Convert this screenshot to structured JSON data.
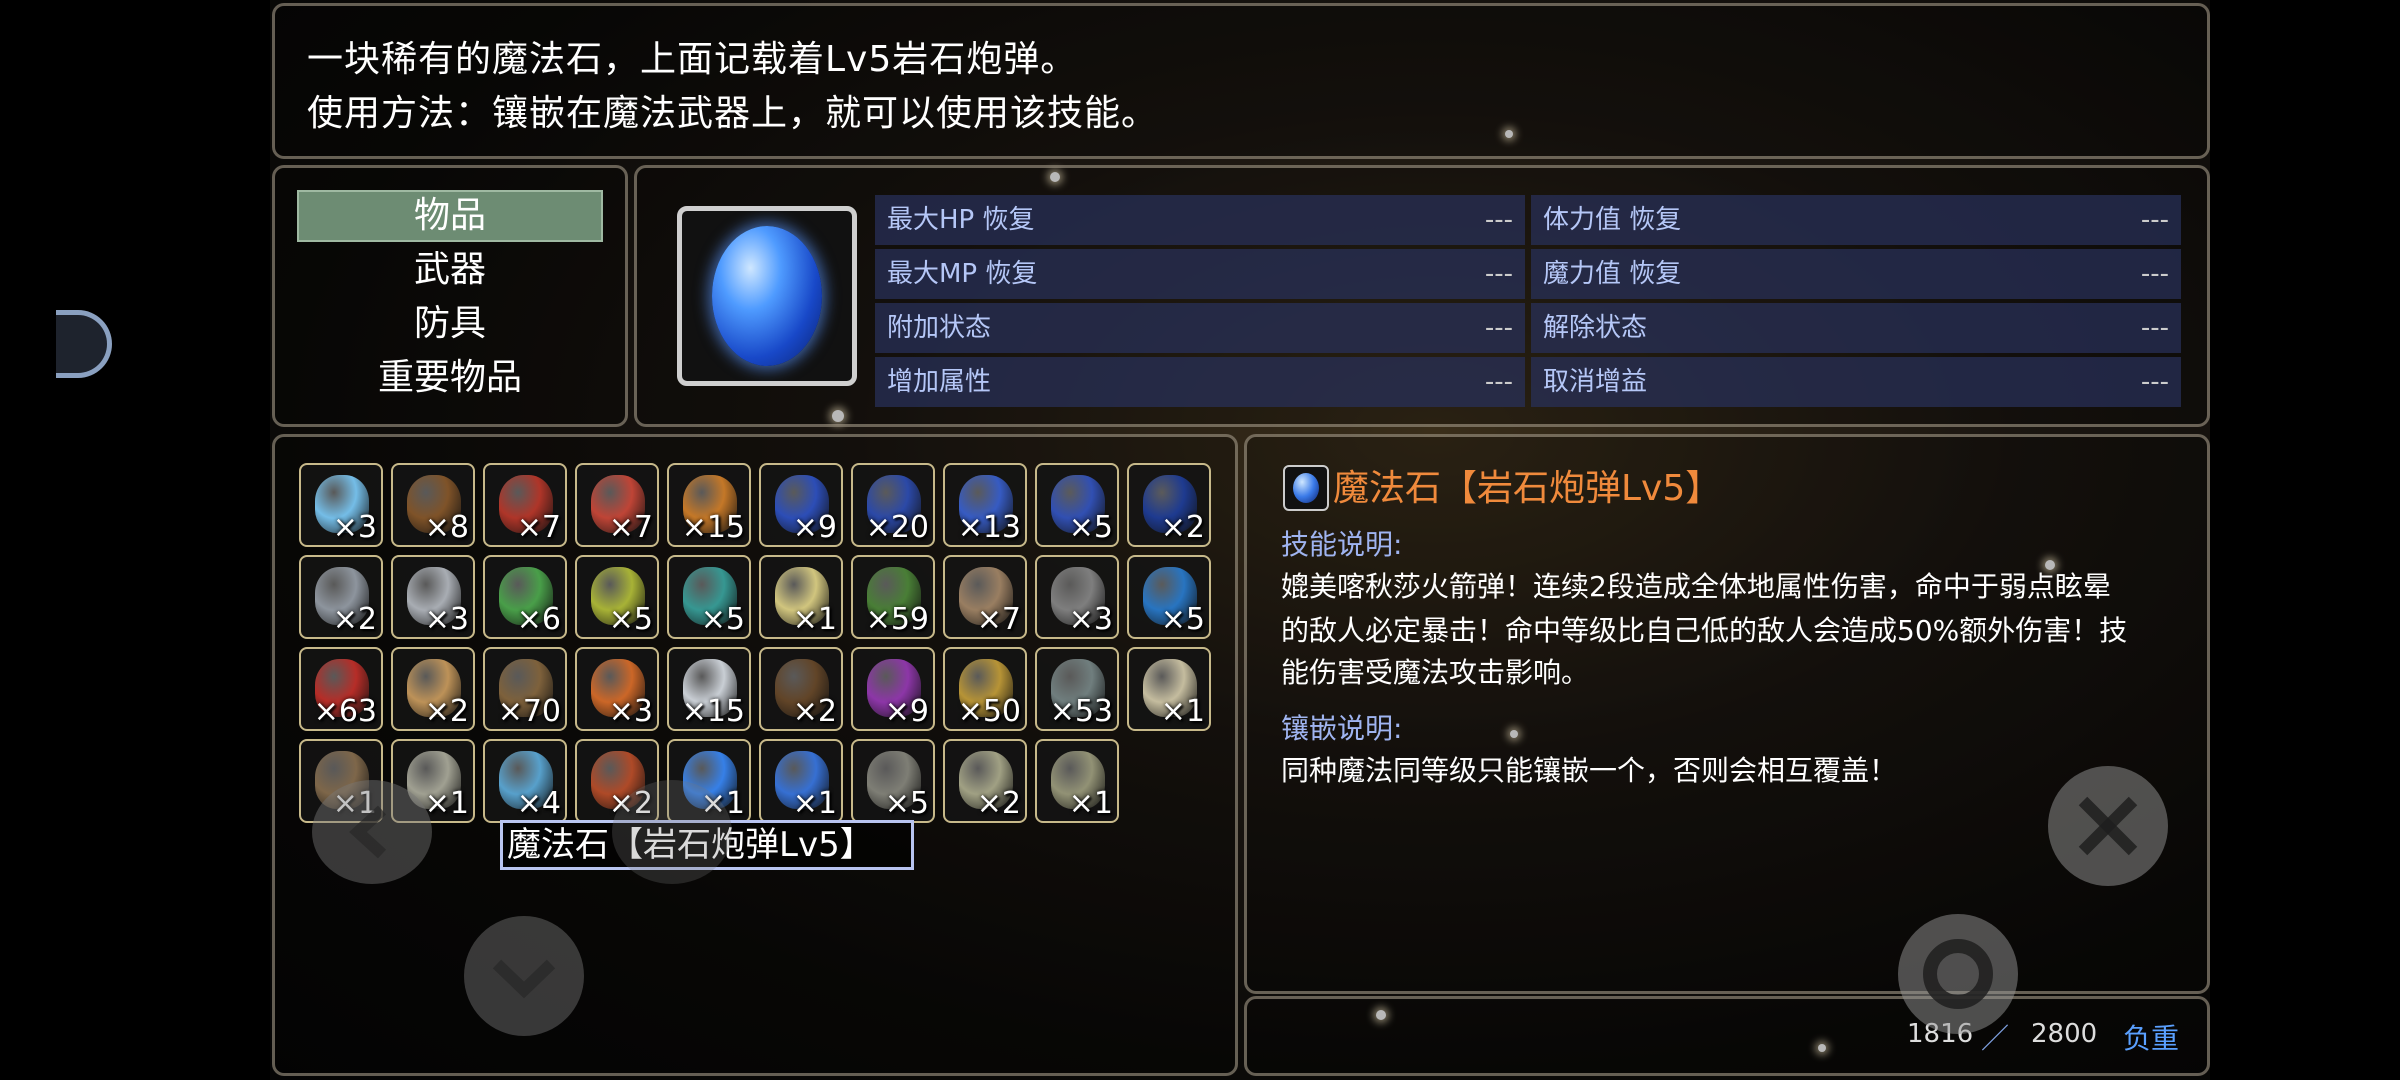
{
  "help": {
    "line1": "一块稀有的魔法石，上面记载着Lv5岩石炮弹。",
    "line2": "使用方法：镶嵌在魔法武器上，就可以使用该技能。"
  },
  "categories": [
    "物品",
    "武器",
    "防具",
    "重要物品"
  ],
  "selected_category": "物品",
  "stats": [
    {
      "label": "最大HP 恢复",
      "value": "---"
    },
    {
      "label": "体力值 恢复",
      "value": "---"
    },
    {
      "label": "最大MP 恢复",
      "value": "---"
    },
    {
      "label": "魔力值 恢复",
      "value": "---"
    },
    {
      "label": "附加状态",
      "value": "---"
    },
    {
      "label": "解除状态",
      "value": "---"
    },
    {
      "label": "增加属性",
      "value": "---"
    },
    {
      "label": "取消增益",
      "value": "---"
    }
  ],
  "inventory": [
    {
      "icon": "crystal-bottle-icon",
      "count": "×3",
      "color": "#7fd0ff"
    },
    {
      "icon": "chest-icon",
      "count": "×8",
      "color": "#8b5a2b"
    },
    {
      "icon": "red-potion-icon",
      "count": "×7",
      "color": "#c0392b"
    },
    {
      "icon": "red-potion-icon",
      "count": "×7",
      "color": "#d24a3a"
    },
    {
      "icon": "orange-potion-icon",
      "count": "×15",
      "color": "#d8832a"
    },
    {
      "icon": "blue-potion-icon",
      "count": "×9",
      "color": "#2f54c9"
    },
    {
      "icon": "blue-potion-icon",
      "count": "×20",
      "color": "#2e4fb8"
    },
    {
      "icon": "blue-potion-icon",
      "count": "×13",
      "color": "#3a63d6"
    },
    {
      "icon": "blue-potion-icon",
      "count": "×5",
      "color": "#3456c4"
    },
    {
      "icon": "blue-flask-icon",
      "count": "×2",
      "color": "#1f3f9e"
    },
    {
      "icon": "grey-potion-icon",
      "count": "×2",
      "color": "#9ba3ad"
    },
    {
      "icon": "grey-potion-icon",
      "count": "×3",
      "color": "#b9bec5"
    },
    {
      "icon": "green-potion-icon",
      "count": "×6",
      "color": "#4fae4f"
    },
    {
      "icon": "yellow-green-potion-icon",
      "count": "×5",
      "color": "#b8c43a"
    },
    {
      "icon": "teal-potion-icon",
      "count": "×5",
      "color": "#3aa6a0"
    },
    {
      "icon": "skull-flask-icon",
      "count": "×1",
      "color": "#e6d98a"
    },
    {
      "icon": "herb-icon",
      "count": "×59",
      "color": "#4f8a3a"
    },
    {
      "icon": "root-icon",
      "count": "×7",
      "color": "#a88a6a"
    },
    {
      "icon": "lantern-icon",
      "count": "×3",
      "color": "#8a8a8a"
    },
    {
      "icon": "blue-orb-icon",
      "count": "×5",
      "color": "#2a7fd4"
    },
    {
      "icon": "apple-icon",
      "count": "×63",
      "color": "#c8302a"
    },
    {
      "icon": "bread-icon",
      "count": "×2",
      "color": "#d0a060"
    },
    {
      "icon": "wood-icon",
      "count": "×70",
      "color": "#8a6a40"
    },
    {
      "icon": "torch-icon",
      "count": "×3",
      "color": "#e0702a"
    },
    {
      "icon": "white-potion-icon",
      "count": "×15",
      "color": "#dde3ea"
    },
    {
      "icon": "brown-bottle-icon",
      "count": "×2",
      "color": "#6a4a2a"
    },
    {
      "icon": "purple-potion-icon",
      "count": "×9",
      "color": "#9a3ab8"
    },
    {
      "icon": "gold-bar-icon",
      "count": "×50",
      "color": "#c9a23a"
    },
    {
      "icon": "pickaxe-icon",
      "count": "×53",
      "color": "#7a8a8a"
    },
    {
      "icon": "bone-icon",
      "count": "×1",
      "color": "#d8cfae"
    },
    {
      "icon": "shovel-icon",
      "count": "×1",
      "color": "#8a7050"
    },
    {
      "icon": "flashlight-icon",
      "count": "×1",
      "color": "#b0b0a0"
    },
    {
      "icon": "ice-crown-icon",
      "count": "×4",
      "color": "#5fb0e0"
    },
    {
      "icon": "scroll-icon",
      "count": "×2",
      "color": "#c0502a"
    },
    {
      "icon": "magic-stone-icon",
      "count": "×1",
      "color": "#3a8cff"
    },
    {
      "icon": "magic-stone-icon",
      "count": "×1",
      "color": "#3a7ae8"
    },
    {
      "icon": "rock-icon",
      "count": "×5",
      "color": "#8a8a80"
    },
    {
      "icon": "note-icon",
      "count": "×2",
      "color": "#b0b090"
    },
    {
      "icon": "note-icon",
      "count": "×1",
      "color": "#a0a080"
    }
  ],
  "selected_item_name": "魔法石【岩石炮弹Lv5】",
  "detail": {
    "title": "魔法石【岩石炮弹Lv5】",
    "skill_heading": "技能说明:",
    "skill_line1": "媲美喀秋莎火箭弹！连续2段造成全体地属性伤害，命中于弱点眩晕",
    "skill_line2": "的敌人必定暴击！命中等级比自己低的敌人会造成50%额外伤害！技",
    "skill_line3": "能伤害受魔法攻击影响。",
    "inlay_heading": "镶嵌说明:",
    "inlay_line1": "同种魔法同等级只能镶嵌一个，否则会相互覆盖！"
  },
  "weight": {
    "current": "1816",
    "separator": "／",
    "max": "2800",
    "label": "负重"
  },
  "colors": {
    "accent_orange": "#f08a3c",
    "heading_blue": "#9fb4f0",
    "weight_blue": "#5aa0ff"
  }
}
